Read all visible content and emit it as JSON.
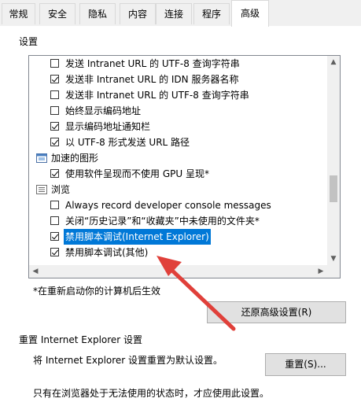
{
  "tabs": [
    {
      "label": "常规",
      "active": false
    },
    {
      "label": "安全",
      "active": false
    },
    {
      "label": "隐私",
      "active": false
    },
    {
      "label": "内容",
      "active": false
    },
    {
      "label": "连接",
      "active": false
    },
    {
      "label": "程序",
      "active": false
    },
    {
      "label": "高级",
      "active": true
    }
  ],
  "settings_group": {
    "label": "设置"
  },
  "settings_list": {
    "rows": [
      {
        "type": "checkbox",
        "checked": false,
        "label": "发送 Intranet URL 的 UTF-8 查询字符串"
      },
      {
        "type": "checkbox",
        "checked": true,
        "label": "发送非 Intranet URL 的 IDN 服务器名称"
      },
      {
        "type": "checkbox",
        "checked": false,
        "label": "发送非 Intranet URL 的 UTF-8 查询字符串"
      },
      {
        "type": "checkbox",
        "checked": false,
        "label": "始终显示编码地址"
      },
      {
        "type": "checkbox",
        "checked": true,
        "label": "显示编码地址通知栏"
      },
      {
        "type": "checkbox",
        "checked": true,
        "label": "以 UTF-8 形式发送 URL 路径"
      },
      {
        "type": "category",
        "icon": "accelerated-graphics-icon",
        "label": "加速的图形"
      },
      {
        "type": "checkbox",
        "checked": true,
        "label": "使用软件呈现而不使用 GPU 呈现*"
      },
      {
        "type": "category",
        "icon": "browsing-icon",
        "label": "浏览"
      },
      {
        "type": "checkbox",
        "checked": false,
        "label": "Always record developer console messages"
      },
      {
        "type": "checkbox",
        "checked": false,
        "label": "关闭“历史记录”和“收藏夹”中未使用的文件夹*"
      },
      {
        "type": "checkbox",
        "checked": true,
        "selected": true,
        "label": "禁用脚本调试(Internet Explorer)"
      },
      {
        "type": "checkbox",
        "checked": true,
        "label": "禁用脚本调试(其他)"
      }
    ]
  },
  "restart_note": "*在重新启动你的计算机后生效",
  "restore_button": "还原高级设置(R)",
  "reset_group": {
    "label": "重置 Internet Explorer 设置",
    "description": "将 Internet Explorer 设置重置为默认设置。",
    "reset_button": "重置(S)...",
    "warning": "只有在浏览器处于无法使用的状态时，才应使用此设置。"
  },
  "colors": {
    "selection": "#0078d7",
    "annotation_arrow": "#e0403a"
  }
}
